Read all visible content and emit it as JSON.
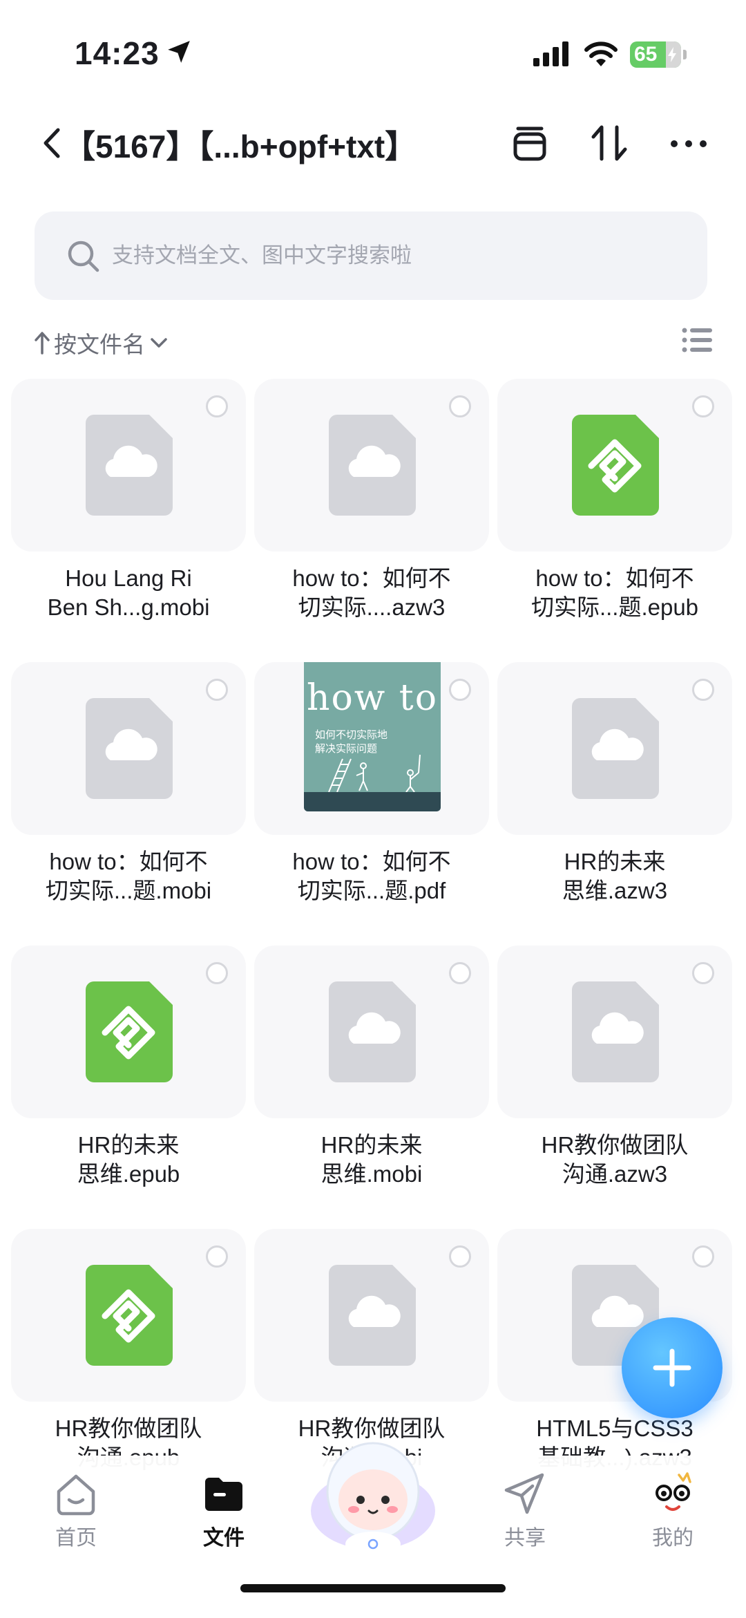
{
  "status": {
    "time": "14:23",
    "battery": "65"
  },
  "header": {
    "title": "【5167】【...b+opf+txt】"
  },
  "search": {
    "placeholder": "支持文档全文、图中文字搜索啦"
  },
  "sort": {
    "label": "按文件名"
  },
  "files": [
    {
      "name_line1": "Hou Lang Ri",
      "name_line2": "Ben Sh...g.mobi",
      "icon": "cloud-file-icon"
    },
    {
      "name_line1": "how to：如何不",
      "name_line2": "切实际....azw3",
      "icon": "cloud-file-icon"
    },
    {
      "name_line1": "how to：如何不",
      "name_line2": "切实际...题.epub",
      "icon": "epub-icon"
    },
    {
      "name_line1": "how to：如何不",
      "name_line2": "切实际...题.mobi",
      "icon": "cloud-file-icon"
    },
    {
      "name_line1": "how to：如何不",
      "name_line2": "切实际...题.pdf",
      "icon": "book-cover-thumbnail",
      "cover": {
        "title": "how to",
        "subtitle_line1": "如何不切实际地",
        "subtitle_line2": "解决实际问题"
      }
    },
    {
      "name_line1": "HR的未来",
      "name_line2": "思维.azw3",
      "icon": "cloud-file-icon"
    },
    {
      "name_line1": "HR的未来",
      "name_line2": "思维.epub",
      "icon": "epub-icon"
    },
    {
      "name_line1": "HR的未来",
      "name_line2": "思维.mobi",
      "icon": "cloud-file-icon"
    },
    {
      "name_line1": "HR教你做团队",
      "name_line2": "沟通.azw3",
      "icon": "cloud-file-icon"
    },
    {
      "name_line1": "HR教你做团队",
      "name_line2": "沟通.epub",
      "icon": "epub-icon"
    },
    {
      "name_line1": "HR教你做团队",
      "name_line2": "沟通.mobi",
      "icon": "cloud-file-icon"
    },
    {
      "name_line1": "HTML5与CSS3",
      "name_line2": "基础教...).azw3",
      "icon": "cloud-file-icon"
    }
  ],
  "tabbar": {
    "home": "首页",
    "files": "文件",
    "share": "共享",
    "mine": "我的"
  },
  "colors": {
    "accent": "#2a8dff",
    "epub_green": "#6cc24a",
    "file_gray": "#d4d5da"
  }
}
